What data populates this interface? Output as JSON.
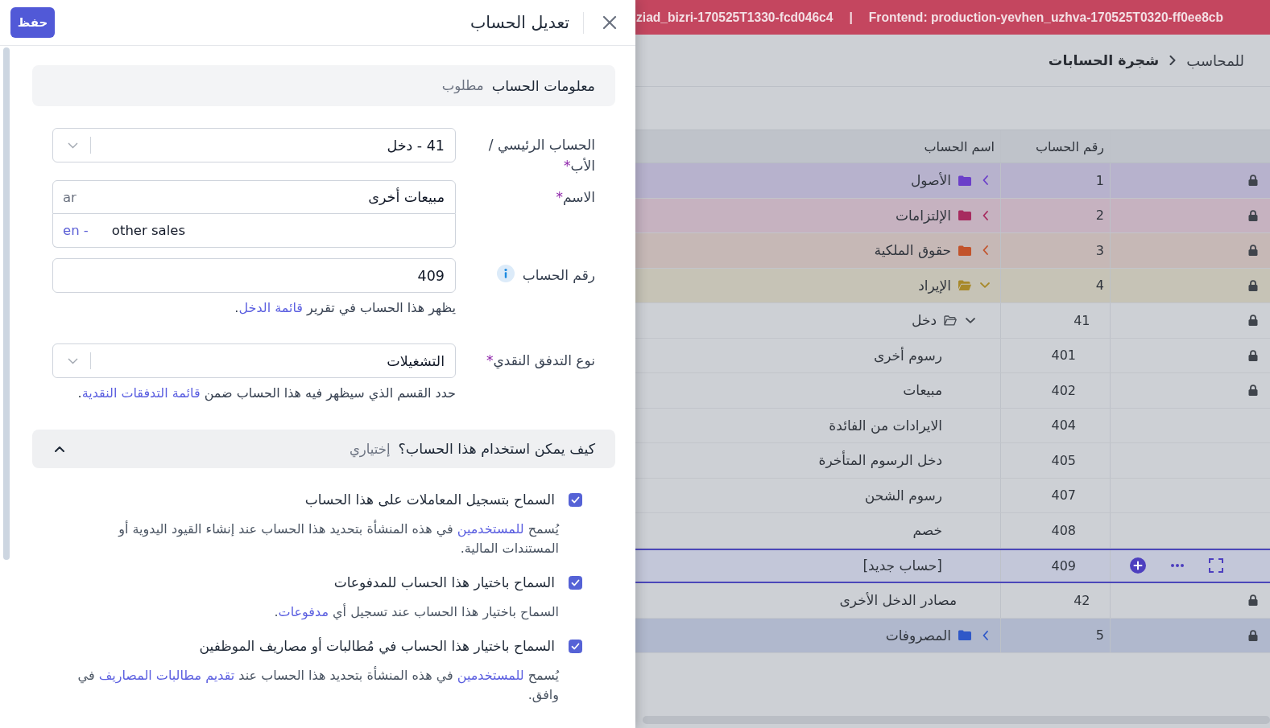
{
  "drawer": {
    "title": "تعديل الحساب",
    "save_label": "حفظ",
    "info_section": {
      "title": "معلومات الحساب",
      "tag": "مطلوب"
    },
    "fields": [
      {
        "kind": "select",
        "label": "الحساب الرئيسي / الأب",
        "required_mark": "*",
        "info": false,
        "value": "41 - دخل"
      },
      {
        "kind": "multilang",
        "label": "الاسم",
        "required_mark": "*",
        "info": false,
        "translations": [
          {
            "kind": "base",
            "lang": "ar",
            "value": "مبيعات أخرى"
          },
          {
            "kind": "translation",
            "lang": "en -",
            "value": "other sales"
          }
        ]
      },
      {
        "kind": "text",
        "label": "رقم الحساب",
        "info": true,
        "value": "409",
        "help": [
          {
            "kind": "text",
            "text": "يظهر هذا الحساب في تقرير "
          },
          {
            "kind": "link",
            "text": "قائمة الدخل"
          },
          {
            "kind": "text",
            "text": "."
          }
        ]
      },
      {
        "kind": "select",
        "label": "نوع التدفق النقدي",
        "required_mark": "*",
        "info": false,
        "value": "التشغيلات",
        "help": [
          {
            "kind": "text",
            "text": "حدد القسم الذي سيظهر فيه هذا الحساب ضمن "
          },
          {
            "kind": "link",
            "text": "قائمة التدفقات النقدية"
          },
          {
            "kind": "text",
            "text": "."
          }
        ]
      }
    ],
    "usage_section": {
      "title": "كيف يمكن استخدام هذا الحساب؟",
      "tag": "إختياري",
      "expanded": true
    },
    "options": [
      {
        "label": "السماح بتسجيل المعاملات على هذا الحساب",
        "checked": true,
        "description": [
          {
            "kind": "text",
            "text": "يُسمح "
          },
          {
            "kind": "link",
            "text": "للمستخدمين"
          },
          {
            "kind": "text",
            "text": " في هذه المنشأة بتحديد هذا الحساب عند إنشاء القيود اليدوية أو المستندات المالية."
          }
        ]
      },
      {
        "label": "السماح باختيار هذا الحساب للمدفوعات",
        "checked": true,
        "description": [
          {
            "kind": "text",
            "text": "السماح باختيار هذا الحساب عند تسجيل أي "
          },
          {
            "kind": "link",
            "text": "مدفوعات"
          },
          {
            "kind": "text",
            "text": "."
          }
        ]
      },
      {
        "label": "السماح باختيار هذا الحساب في مُطالبات أو مصاريف الموظفين",
        "checked": true,
        "description": [
          {
            "kind": "text",
            "text": "يُسمح "
          },
          {
            "kind": "link",
            "text": "للمستخدمين"
          },
          {
            "kind": "text",
            "text": " في هذه المنشأة بتحديد هذا الحساب عند "
          },
          {
            "kind": "link",
            "text": "تقديم مطالبات المصاريف"
          },
          {
            "kind": "text",
            "text": " في وافق."
          }
        ]
      }
    ]
  },
  "page": {
    "banner": {
      "backend": "ziad_bizri-170525T1330-fcd046c4",
      "separator": "|",
      "frontend": "Frontend: production-yevhen_uzhva-170525T0320-ff0ee8cb"
    },
    "breadcrumb": [
      {
        "label": "للمحاسب",
        "current": false
      },
      {
        "label": "شجرة الحسابات",
        "current": true
      }
    ],
    "tree": {
      "columns": [
        "رقم الحساب",
        "اسم الحساب"
      ],
      "rows": [
        {
          "kind": "folder",
          "number": "1",
          "name": "الأصول",
          "color": "#6b3fc9",
          "expanded": false,
          "locked": true,
          "selected": false
        },
        {
          "kind": "folder",
          "number": "2",
          "name": "الإلتزامات",
          "color": "#a72b5f",
          "expanded": false,
          "locked": true,
          "selected": false
        },
        {
          "kind": "folder",
          "number": "3",
          "name": "حقوق الملكية",
          "color": "#c2532b",
          "expanded": false,
          "locked": true,
          "selected": false
        },
        {
          "kind": "folder",
          "number": "4",
          "name": "الإيراد",
          "color": "#a8892a",
          "expanded": true,
          "locked": true,
          "selected": false,
          "children": [
            {
              "kind": "folder",
              "number": "41",
              "name": "دخل",
              "expanded": true,
              "locked": true,
              "selected": false,
              "children": [
                {
                  "kind": "account",
                  "number": "401",
                  "name": "رسوم أخرى",
                  "locked": true,
                  "selected": false
                },
                {
                  "kind": "account",
                  "number": "402",
                  "name": "مبيعات",
                  "locked": true,
                  "selected": false
                },
                {
                  "kind": "account",
                  "number": "404",
                  "name": "الايرادات من الفائدة",
                  "locked": false,
                  "selected": false
                },
                {
                  "kind": "account",
                  "number": "405",
                  "name": "دخل الرسوم المتأخرة",
                  "locked": false,
                  "selected": false
                },
                {
                  "kind": "account",
                  "number": "407",
                  "name": "رسوم الشحن",
                  "locked": false,
                  "selected": false
                },
                {
                  "kind": "account",
                  "number": "408",
                  "name": "خصم",
                  "locked": false,
                  "selected": false
                },
                {
                  "kind": "account",
                  "number": "409",
                  "name": "[حساب جديد]",
                  "locked": false,
                  "selected": true
                }
              ]
            },
            {
              "kind": "account",
              "number": "42",
              "name": "مصادر الدخل الأخرى",
              "locked": true,
              "selected": false
            }
          ]
        },
        {
          "kind": "folder",
          "number": "5",
          "name": "المصروفات",
          "color": "#2f58c8",
          "expanded": false,
          "locked": true,
          "selected": false
        }
      ]
    }
  }
}
